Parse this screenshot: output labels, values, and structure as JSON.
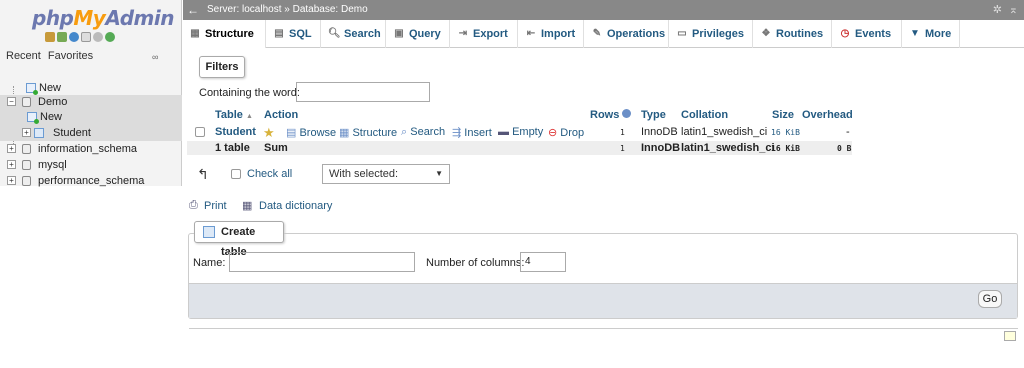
{
  "logo": {
    "php": "php",
    "my": "My",
    "admin": "Admin"
  },
  "left": {
    "recent": "Recent",
    "favorites": "Favorites",
    "tree": [
      {
        "label": "New"
      },
      {
        "label": "Demo"
      },
      {
        "label": "New"
      },
      {
        "label": "Student"
      },
      {
        "label": "information_schema"
      },
      {
        "label": "mysql"
      },
      {
        "label": "performance_schema"
      }
    ]
  },
  "topbar": {
    "server": "Server: localhost",
    "sep": "»",
    "database": "Database: Demo"
  },
  "tabs": [
    {
      "label": "Structure",
      "icon": "structure-icon"
    },
    {
      "label": "SQL",
      "icon": "sql-icon"
    },
    {
      "label": "Search",
      "icon": "search-icon"
    },
    {
      "label": "Query",
      "icon": "query-icon"
    },
    {
      "label": "Export",
      "icon": "export-icon"
    },
    {
      "label": "Import",
      "icon": "import-icon"
    },
    {
      "label": "Operations",
      "icon": "wrench-icon"
    },
    {
      "label": "Privileges",
      "icon": "privileges-icon"
    },
    {
      "label": "Routines",
      "icon": "routines-icon"
    },
    {
      "label": "Events",
      "icon": "clock-icon"
    },
    {
      "label": "More",
      "icon": "triangle-down-icon"
    }
  ],
  "filters": {
    "legend": "Filters",
    "label": "Containing the word:",
    "value": ""
  },
  "table": {
    "headers": {
      "table": "Table",
      "sort": "▲",
      "action": "Action",
      "rows": "Rows",
      "type": "Type",
      "collation": "Collation",
      "size": "Size",
      "overhead": "Overhead"
    },
    "row": {
      "name": "Student",
      "browse": "Browse",
      "structure": "Structure",
      "search": "Search",
      "insert": "Insert",
      "empty": "Empty",
      "drop": "Drop",
      "rows": "1",
      "type": "InnoDB",
      "collation": "latin1_swedish_ci",
      "size": "16 KiB",
      "overhead": "-"
    },
    "summary": {
      "count": "1 table",
      "sum": "Sum",
      "rows": "1",
      "type": "InnoDB",
      "collation": "latin1_swedish_ci",
      "size": "16 KiB",
      "overhead": "0 B"
    }
  },
  "bulk": {
    "check_all": "Check all",
    "with_selected": "With selected:"
  },
  "links": {
    "print": "Print",
    "data_dictionary": "Data dictionary"
  },
  "create_table": {
    "legend": "Create table",
    "name_label": "Name:",
    "name_value": "",
    "cols_label": "Number of columns:",
    "cols_value": "4",
    "go": "Go"
  },
  "colors": {
    "link": "#235a81",
    "topbar": "#888888",
    "footer": "#dfe3e9"
  }
}
